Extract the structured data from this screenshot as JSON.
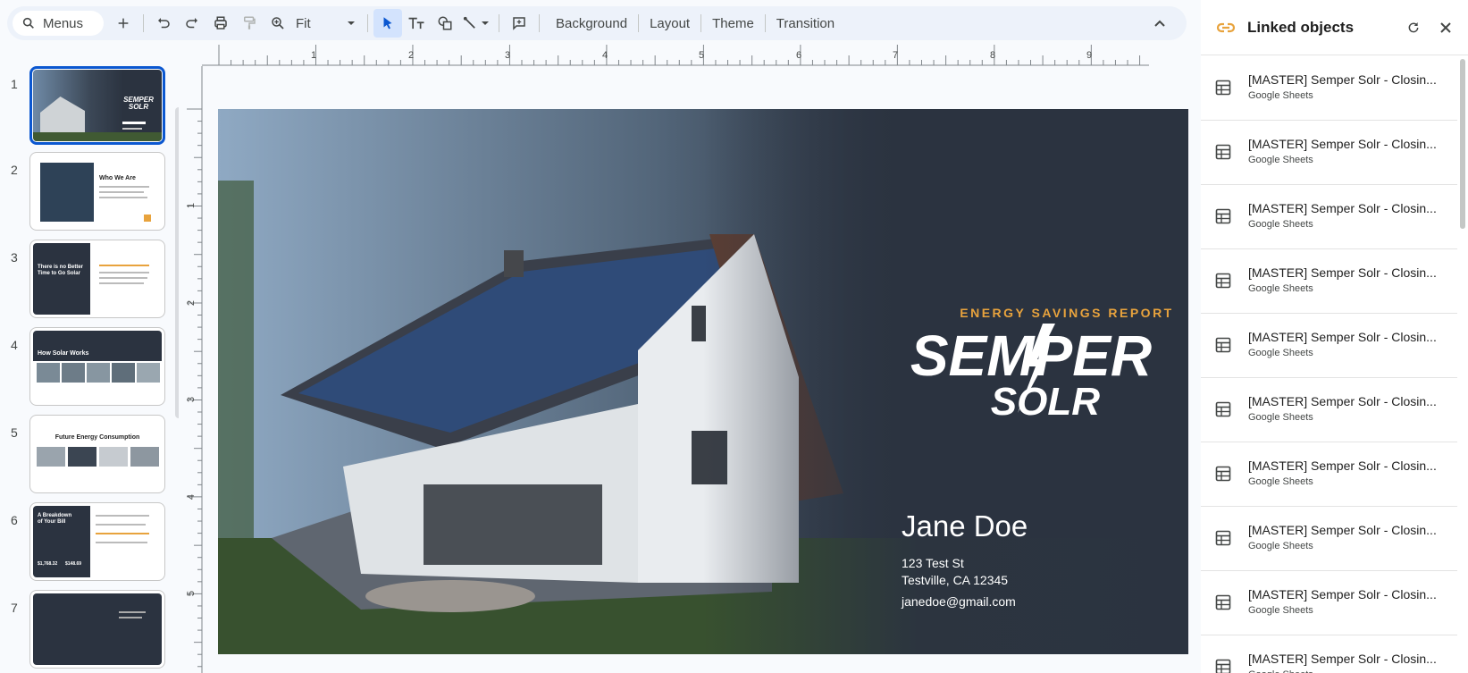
{
  "toolbar": {
    "menus_label": "Menus",
    "zoom_value": "Fit",
    "background_label": "Background",
    "layout_label": "Layout",
    "theme_label": "Theme",
    "transition_label": "Transition",
    "icons": [
      "search-icon",
      "add-icon",
      "undo-icon",
      "redo-icon",
      "print-icon",
      "paint-format-icon",
      "zoom-icon",
      "select-icon",
      "text-box-icon",
      "shape-icon",
      "line-icon",
      "comment-icon",
      "collapse-icon"
    ]
  },
  "thumbnails": [
    {
      "number": "1",
      "title": "SEMPER SOLR"
    },
    {
      "number": "2",
      "title": "Who We Are"
    },
    {
      "number": "3",
      "title": "There is no Better Time to Go Solar"
    },
    {
      "number": "4",
      "title": "How Solar Works"
    },
    {
      "number": "5",
      "title": "Future Energy Consumption"
    },
    {
      "number": "6",
      "title": "A Breakdown of Your Bill",
      "amounts": [
        "$1,768.32",
        "$148.69"
      ]
    },
    {
      "number": "7",
      "title": ""
    }
  ],
  "ruler": {
    "horizontal": [
      "1",
      "2",
      "3",
      "4",
      "5",
      "6",
      "7",
      "8",
      "9"
    ],
    "vertical": [
      "1",
      "2",
      "3",
      "4",
      "5"
    ]
  },
  "slide": {
    "report_label": "ENERGY SAVINGS REPORT",
    "brand_top": "SEMPER",
    "brand_bottom": "SOLR",
    "name": "Jane Doe",
    "address_line1": "123 Test St",
    "address_line2": "Testville, CA 12345",
    "email": "janedoe@gmail.com",
    "colors": {
      "accent": "#e8a33d",
      "slide_bg": "#2b3340"
    }
  },
  "panel": {
    "title": "Linked objects",
    "items": [
      {
        "title": "[MASTER] Semper Solr - Closin...",
        "source": "Google Sheets"
      },
      {
        "title": "[MASTER] Semper Solr - Closin...",
        "source": "Google Sheets"
      },
      {
        "title": "[MASTER] Semper Solr - Closin...",
        "source": "Google Sheets"
      },
      {
        "title": "[MASTER] Semper Solr - Closin...",
        "source": "Google Sheets"
      },
      {
        "title": "[MASTER] Semper Solr - Closin...",
        "source": "Google Sheets"
      },
      {
        "title": "[MASTER] Semper Solr - Closin...",
        "source": "Google Sheets"
      },
      {
        "title": "[MASTER] Semper Solr - Closin...",
        "source": "Google Sheets"
      },
      {
        "title": "[MASTER] Semper Solr - Closin...",
        "source": "Google Sheets"
      },
      {
        "title": "[MASTER] Semper Solr - Closin...",
        "source": "Google Sheets"
      },
      {
        "title": "[MASTER] Semper Solr - Closin...",
        "source": "Google Sheets"
      }
    ]
  }
}
